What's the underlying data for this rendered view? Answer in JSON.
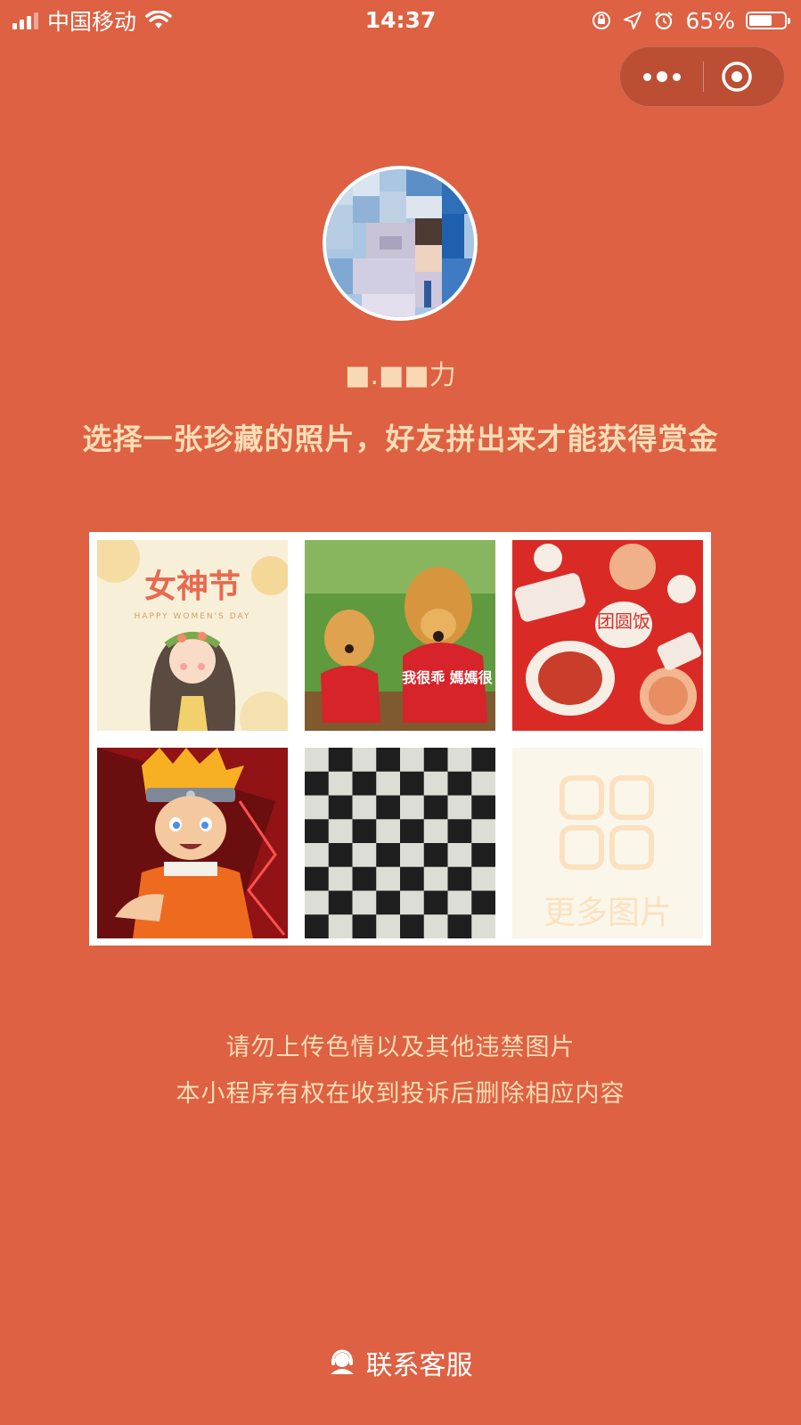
{
  "status_bar": {
    "carrier": "中国移动",
    "time": "14:37",
    "battery_percent": "65%",
    "battery_level": 0.65,
    "icons": [
      "signal-icon",
      "wifi-icon",
      "orientation-lock-icon",
      "location-icon",
      "alarm-icon",
      "battery-icon"
    ]
  },
  "capsule": {
    "icons": [
      "more-icon",
      "close-circle-icon"
    ]
  },
  "profile": {
    "nickname": "■.■■力",
    "avatar": "pixelated-avatar"
  },
  "tagline": "选择一张珍藏的照片，好友拼出来才能获得赏金",
  "photos": [
    {
      "name": "womens-day",
      "title": "女神节",
      "subtitle": "HAPPY WOMEN'S DAY"
    },
    {
      "name": "golden-retrievers",
      "caption": "我很乖 媽媽很"
    },
    {
      "name": "reunion-dinner",
      "caption": "团圆饭"
    },
    {
      "name": "anime-ninja"
    },
    {
      "name": "checkerboard"
    },
    {
      "name": "more-photos",
      "label": "更多图片"
    }
  ],
  "notices": [
    "请勿上传色情以及其他违禁图片",
    "本小程序有权在收到投诉后删除相应内容"
  ],
  "contact": {
    "label": "联系客服",
    "icon": "customer-service-icon"
  },
  "colors": {
    "background": "#DD6142",
    "accent_text": "#FBDDB6",
    "tile_bg": "#FBF6EA"
  }
}
